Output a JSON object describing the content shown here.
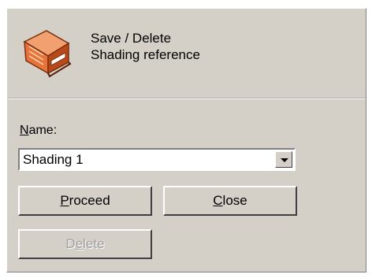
{
  "header": {
    "line1": "Save / Delete",
    "line2": "Shading reference",
    "icon": "book-icon"
  },
  "form": {
    "name_label_mnemonic": "N",
    "name_label_rest": "ame:",
    "name_value": "Shading 1"
  },
  "buttons": {
    "proceed_mnemonic": "P",
    "proceed_rest": "roceed",
    "close_mnemonic": "C",
    "close_rest": "lose",
    "delete_prefix": "D",
    "delete_mnemonic": "e",
    "delete_rest": "lete"
  },
  "colors": {
    "face": "#d4d0c8",
    "icon_orange": "#e8733a",
    "disabled_text": "#a0a0a0"
  }
}
